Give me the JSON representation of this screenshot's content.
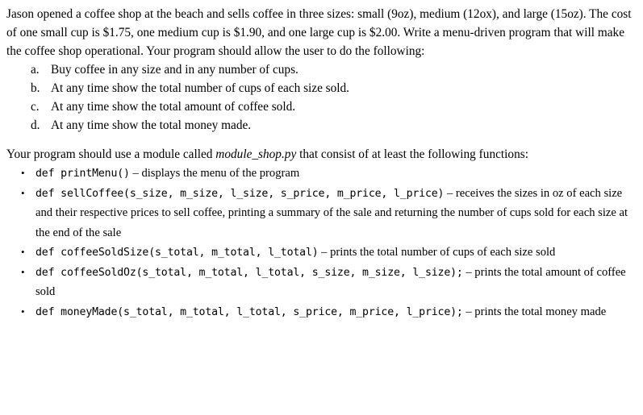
{
  "document": {
    "intro": {
      "paragraph": "Jason opened a coffee shop at the beach and sells coffee in three sizes: small (9oz), medium (12ox), and large (15oz). The cost of one small cup is $1.75, one medium cup is $1.90, and one large cup is $2.00. Write a menu-driven program that will make the coffee shop operational. Your program should allow the user to do the following:"
    },
    "requirements": [
      {
        "marker": "a.",
        "text": "Buy coffee in any size and in any number of cups."
      },
      {
        "marker": "b.",
        "text": "At any time show the total number of cups of each size sold."
      },
      {
        "marker": "c.",
        "text": "At any time show the total amount of coffee sold."
      },
      {
        "marker": "d.",
        "text": "At any time show the total money made."
      }
    ],
    "module_paragraph": {
      "before": "Your program should use a module called ",
      "module_name": "module_shop.py",
      "after": " that consist of at least the following functions:"
    },
    "bullet_glyph": "•",
    "functions": [
      {
        "signature": "def printMenu()",
        "separator": " – ",
        "description": "displays the menu of the program"
      },
      {
        "signature": "def sellCoffee(s_size, m_size, l_size, s_price, m_price, l_price)",
        "separator": " – ",
        "description": "receives the sizes in oz of each size and their respective prices to sell coffee, printing a summary of the sale and returning the number of cups sold for each size at the end of the sale"
      },
      {
        "signature": "def coffeeSoldSize(s_total, m_total, l_total)",
        "separator": " – ",
        "description": "prints the total number of cups of each size sold"
      },
      {
        "signature": "def coffeeSoldOz(s_total, m_total, l_total, s_size, m_size, l_size);",
        "separator": " – ",
        "description": "prints the total amount of coffee sold"
      },
      {
        "signature": "def moneyMade(s_total, m_total, l_total, s_price, m_price, l_price);",
        "separator": " – ",
        "description": "prints the total money made"
      }
    ]
  }
}
